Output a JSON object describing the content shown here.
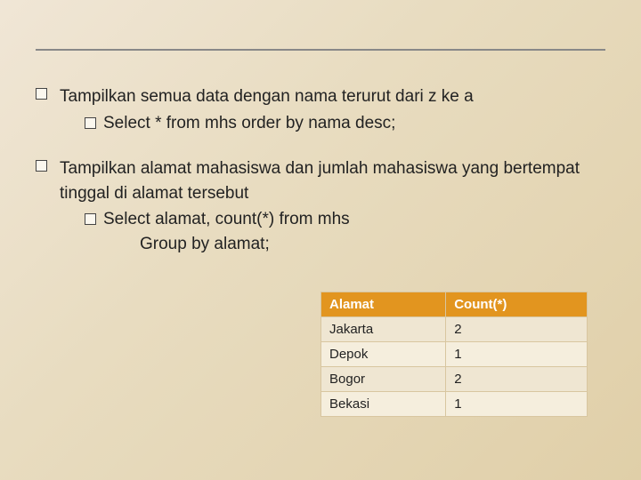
{
  "section1": {
    "title": "Tampilkan semua data dengan nama terurut dari z ke a",
    "sub": "Select * from mhs order by nama desc;"
  },
  "section2": {
    "title": "Tampilkan alamat mahasiswa dan jumlah mahasiswa yang bertempat tinggal di alamat tersebut",
    "sub1": "Select alamat, count(*) from mhs",
    "sub2": "Group by alamat;"
  },
  "table": {
    "headers": {
      "col1": "Alamat",
      "col2": "Count(*)"
    },
    "rows": [
      {
        "alamat": "Jakarta",
        "count": "2"
      },
      {
        "alamat": "Depok",
        "count": "1"
      },
      {
        "alamat": "Bogor",
        "count": "2"
      },
      {
        "alamat": "Bekasi",
        "count": "1"
      }
    ]
  },
  "chart_data": {
    "type": "table",
    "title": "Alamat / Count(*)",
    "columns": [
      "Alamat",
      "Count(*)"
    ],
    "rows": [
      [
        "Jakarta",
        2
      ],
      [
        "Depok",
        1
      ],
      [
        "Bogor",
        2
      ],
      [
        "Bekasi",
        1
      ]
    ]
  }
}
